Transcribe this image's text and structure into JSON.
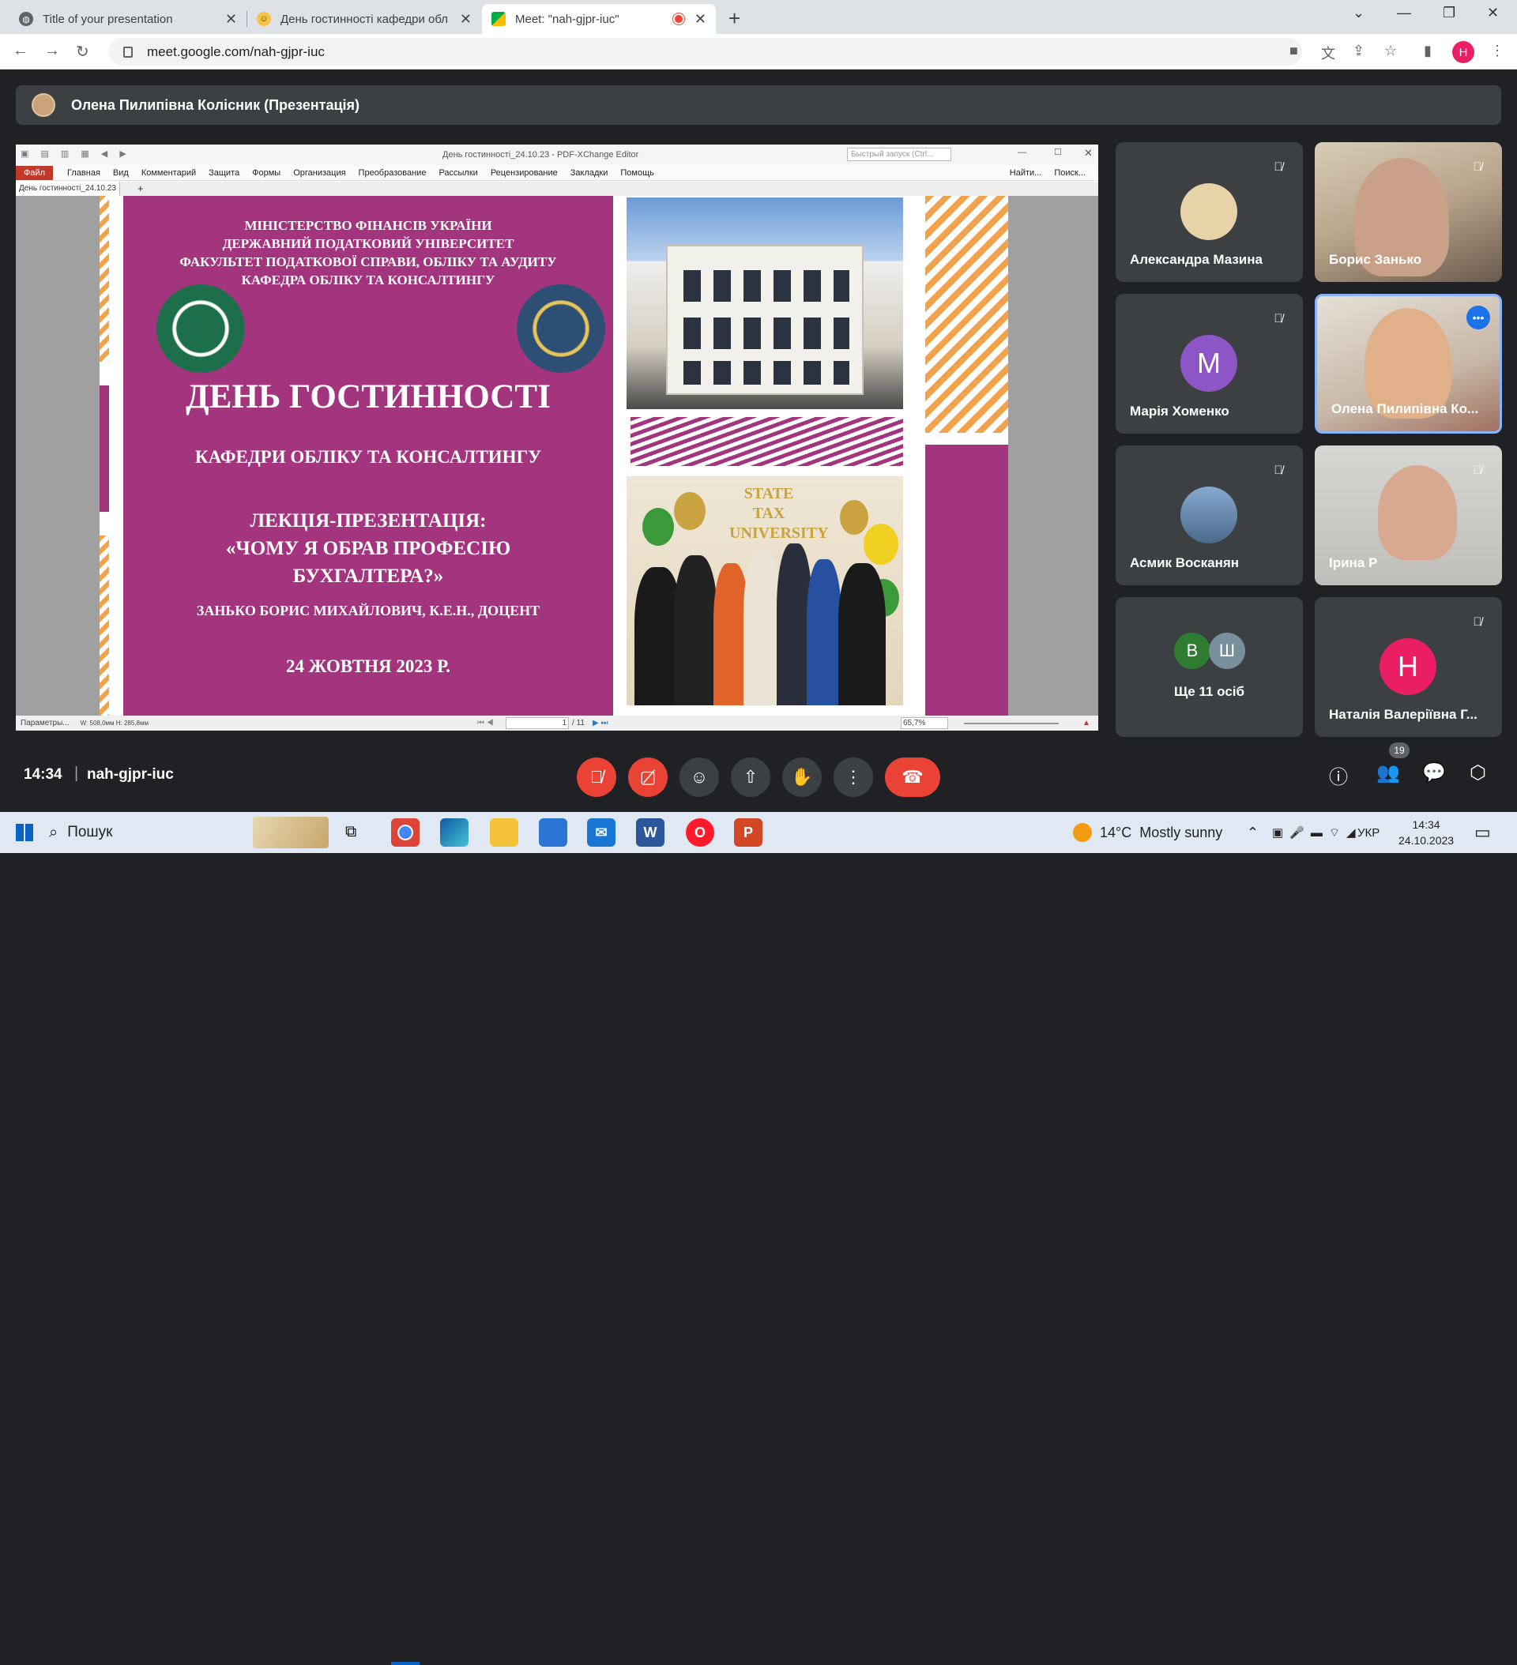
{
  "browser": {
    "tabs": [
      {
        "title": "Title of your presentation",
        "icon": "globe-icon"
      },
      {
        "title": "День гостинності кафедри обл",
        "icon": "smiley-icon"
      },
      {
        "title": "Meet: \"nah-gjpr-iuc\"",
        "icon": "meet-icon",
        "recording": true
      }
    ],
    "url": "meet.google.com/nah-gjpr-iuc",
    "profile_initial": "H"
  },
  "meet": {
    "presenter_bar": "Олена Пилипівна Колісник (Презентація)",
    "time": "14:34",
    "meeting_code": "nah-gjpr-iuc",
    "participants_count": "19",
    "tiles": [
      {
        "name": "Александра Мазина",
        "muted": true,
        "type": "photo-avatar"
      },
      {
        "name": "Борис Занько",
        "muted": true,
        "type": "video"
      },
      {
        "name": "Марія Хоменко",
        "muted": true,
        "type": "letter",
        "letter": "M",
        "color": "#8e55c7"
      },
      {
        "name": "Олена Пилипівна Ко...",
        "muted": false,
        "type": "video",
        "active": true
      },
      {
        "name": "Асмик Восканян",
        "muted": true,
        "type": "photo-avatar"
      },
      {
        "name": "Ірина Р",
        "muted": true,
        "type": "video"
      },
      {
        "name": "Ще 11 осіб",
        "type": "group",
        "letters": [
          "B",
          "Ш"
        ]
      },
      {
        "name": "Наталія Валеріївна Г...",
        "muted": true,
        "type": "letter",
        "letter": "H",
        "color": "#e91e63"
      }
    ]
  },
  "pdf": {
    "window_title": "День гостинності_24.10.23 - PDF-XChange Editor",
    "quick_launch": "Быстрый запуск (Ctrl...",
    "menu": [
      "Файл",
      "Главная",
      "Вид",
      "Комментарий",
      "Защита",
      "Формы",
      "Организация",
      "Преобразование",
      "Рассылки",
      "Рецензирование",
      "Закладки",
      "Помощь"
    ],
    "find": "Найти...",
    "search": "Поиск...",
    "doc_tab": "День гостинності_24.10.23",
    "status_params": "Параметры...",
    "status_dims": "W: 508,0мм H: 285,8мм",
    "page": "1",
    "page_total": "/ 11",
    "zoom": "65,7%"
  },
  "slide": {
    "header_lines": [
      "МІНІСТЕРСТВО ФІНАНСІВ УКРАЇНИ",
      "ДЕРЖАВНИЙ ПОДАТКОВИЙ УНІВЕРСИТЕТ",
      "ФАКУЛЬТЕТ ПОДАТКОВОЇ СПРАВИ, ОБЛІКУ ТА АУДИТУ",
      "КАФЕДРА ОБЛІКУ ТА КОНСАЛТИНГУ"
    ],
    "title": "ДЕНЬ ГОСТИННОСТІ",
    "subtitle": "КАФЕДРИ ОБЛІКУ ТА КОНСАЛТИНГУ",
    "lecture_label": "ЛЕКЦІЯ-ПРЕЗЕНТАЦІЯ:",
    "lecture_line1": "«ЧОМУ Я ОБРАВ ПРОФЕСІЮ",
    "lecture_line2": "БУХГАЛТЕРА?»",
    "author": "ЗАНЬКО БОРИС МИХАЙЛОВИЧ, К.Е.Н., ДОЦЕНТ",
    "date": "24 ЖОВТНЯ 2023 Р.",
    "photo_sign": "STATE TAX UNIVERSITY"
  },
  "taskbar": {
    "search": "Пошук",
    "weather_temp": "14°C",
    "weather_text": "Mostly sunny",
    "lang": "УКР",
    "time": "14:34",
    "date": "24.10.2023"
  },
  "colors": {
    "accent": "#a3347e",
    "stripe": "#f2a24a",
    "danger": "#ea4335",
    "meet_bg": "#202124"
  }
}
